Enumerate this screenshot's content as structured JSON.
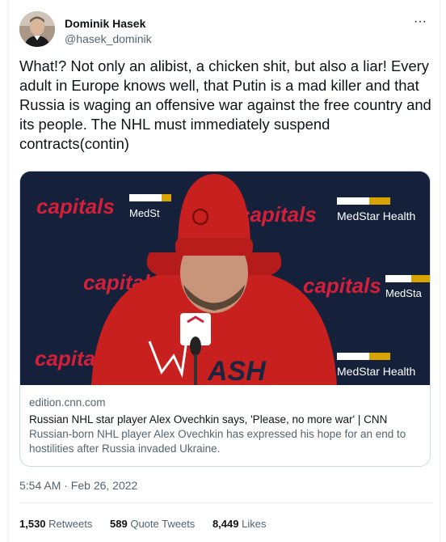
{
  "author": {
    "display_name": "Dominik Hasek",
    "handle": "@hasek_dominik",
    "avatar_icon": "profile-photo-icon"
  },
  "more_icon": "···",
  "tweet": {
    "text": "What!? Not only an alibist, a chicken shit, but also a liar! Every adult in Europe knows well, that Putin is a mad killer and that Russia is waging an offensive war against the free country and its people. The NHL must immediately suspend contracts(contin)"
  },
  "card": {
    "image_texts": {
      "capitals": "capitals",
      "medstar_health": "MedStar Health",
      "medstar_short": "MedSt",
      "medstar_cut": "MedSta",
      "hat_text": "ASH"
    },
    "domain": "edition.cnn.com",
    "title": "Russian NHL star player Alex Ovechkin says, 'Please, no more war' | CNN",
    "description": "Russian-born NHL player Alex Ovechkin has expressed his hope for an end to hostilities after Russia invaded Ukraine."
  },
  "timestamp": "5:54 AM · Feb 26, 2022",
  "stats": {
    "retweets_count": "1,530",
    "retweets_label": "Retweets",
    "quotes_count": "589",
    "quotes_label": "Quote Tweets",
    "likes_count": "8,449",
    "likes_label": "Likes"
  },
  "colors": {
    "capitals_red": "#d31f39",
    "backdrop_navy": "#15213a",
    "hoodie_red": "#c8201e",
    "medstar_gold": "#d8a400"
  }
}
